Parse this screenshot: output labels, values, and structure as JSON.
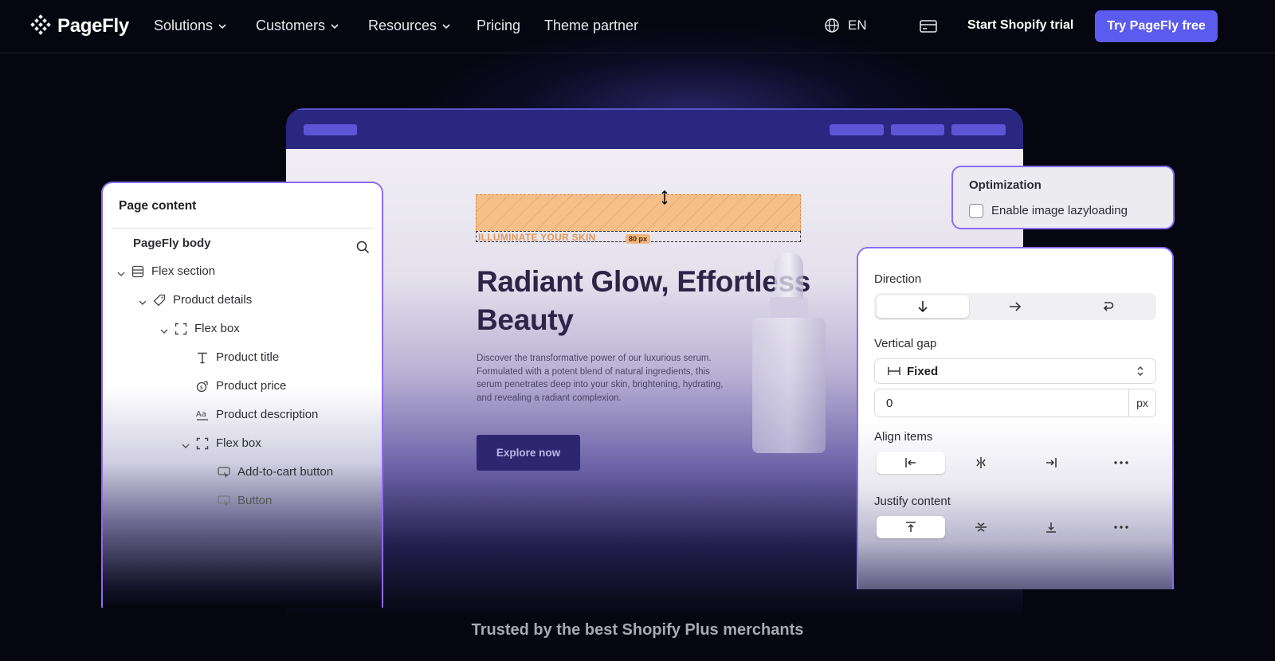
{
  "nav": {
    "brand": "PageFly",
    "items": [
      {
        "label": "Solutions",
        "dropdown": true
      },
      {
        "label": "Customers",
        "dropdown": true
      },
      {
        "label": "Resources",
        "dropdown": true
      },
      {
        "label": "Pricing",
        "dropdown": false
      },
      {
        "label": "Theme partner",
        "dropdown": false
      }
    ],
    "language": "EN",
    "trial_label": "Start Shopify trial",
    "cta_label": "Try PageFly free",
    "accent": "#5b5bf0"
  },
  "preview": {
    "eyebrow": "ILLUMINATE YOUR SKIN",
    "spacing_tag": "80 px",
    "headline": "Radiant Glow, Effortless Beauty",
    "description": "Discover the transformative power of our luxurious serum. Formulated with a potent blend of natural ingredients, this serum penetrates deep into your skin, brightening, hydrating, and revealing a radiant complexion.",
    "button_label": "Explore now"
  },
  "page_content": {
    "title": "Page content",
    "root": "PageFly body",
    "tree": [
      {
        "label": "Flex section",
        "icon": "section-icon",
        "expandable": true
      },
      {
        "label": "Product details",
        "icon": "tag-icon",
        "expandable": true
      },
      {
        "label": "Flex box",
        "icon": "flexbox-icon",
        "expandable": true
      },
      {
        "label": "Product title",
        "icon": "text-icon",
        "expandable": false
      },
      {
        "label": "Product price",
        "icon": "price-icon",
        "expandable": false
      },
      {
        "label": "Product description",
        "icon": "description-icon",
        "expandable": false
      },
      {
        "label": "Flex box",
        "icon": "flexbox-icon",
        "expandable": true
      },
      {
        "label": "Add-to-cart button",
        "icon": "cart-button-icon",
        "expandable": false
      },
      {
        "label": "Button",
        "icon": "button-icon",
        "expandable": false
      }
    ]
  },
  "optimization": {
    "title": "Optimization",
    "lazyload_label": "Enable image lazyloading",
    "lazyload_checked": false
  },
  "layout_panel": {
    "direction_label": "Direction",
    "direction_selected": "vertical",
    "vertical_gap_label": "Vertical gap",
    "gap_mode": "Fixed",
    "gap_value": "0",
    "gap_unit": "px",
    "align_items_label": "Align items",
    "justify_content_label": "Justify content"
  },
  "footer": {
    "trusted": "Trusted by the best Shopify Plus merchants"
  }
}
